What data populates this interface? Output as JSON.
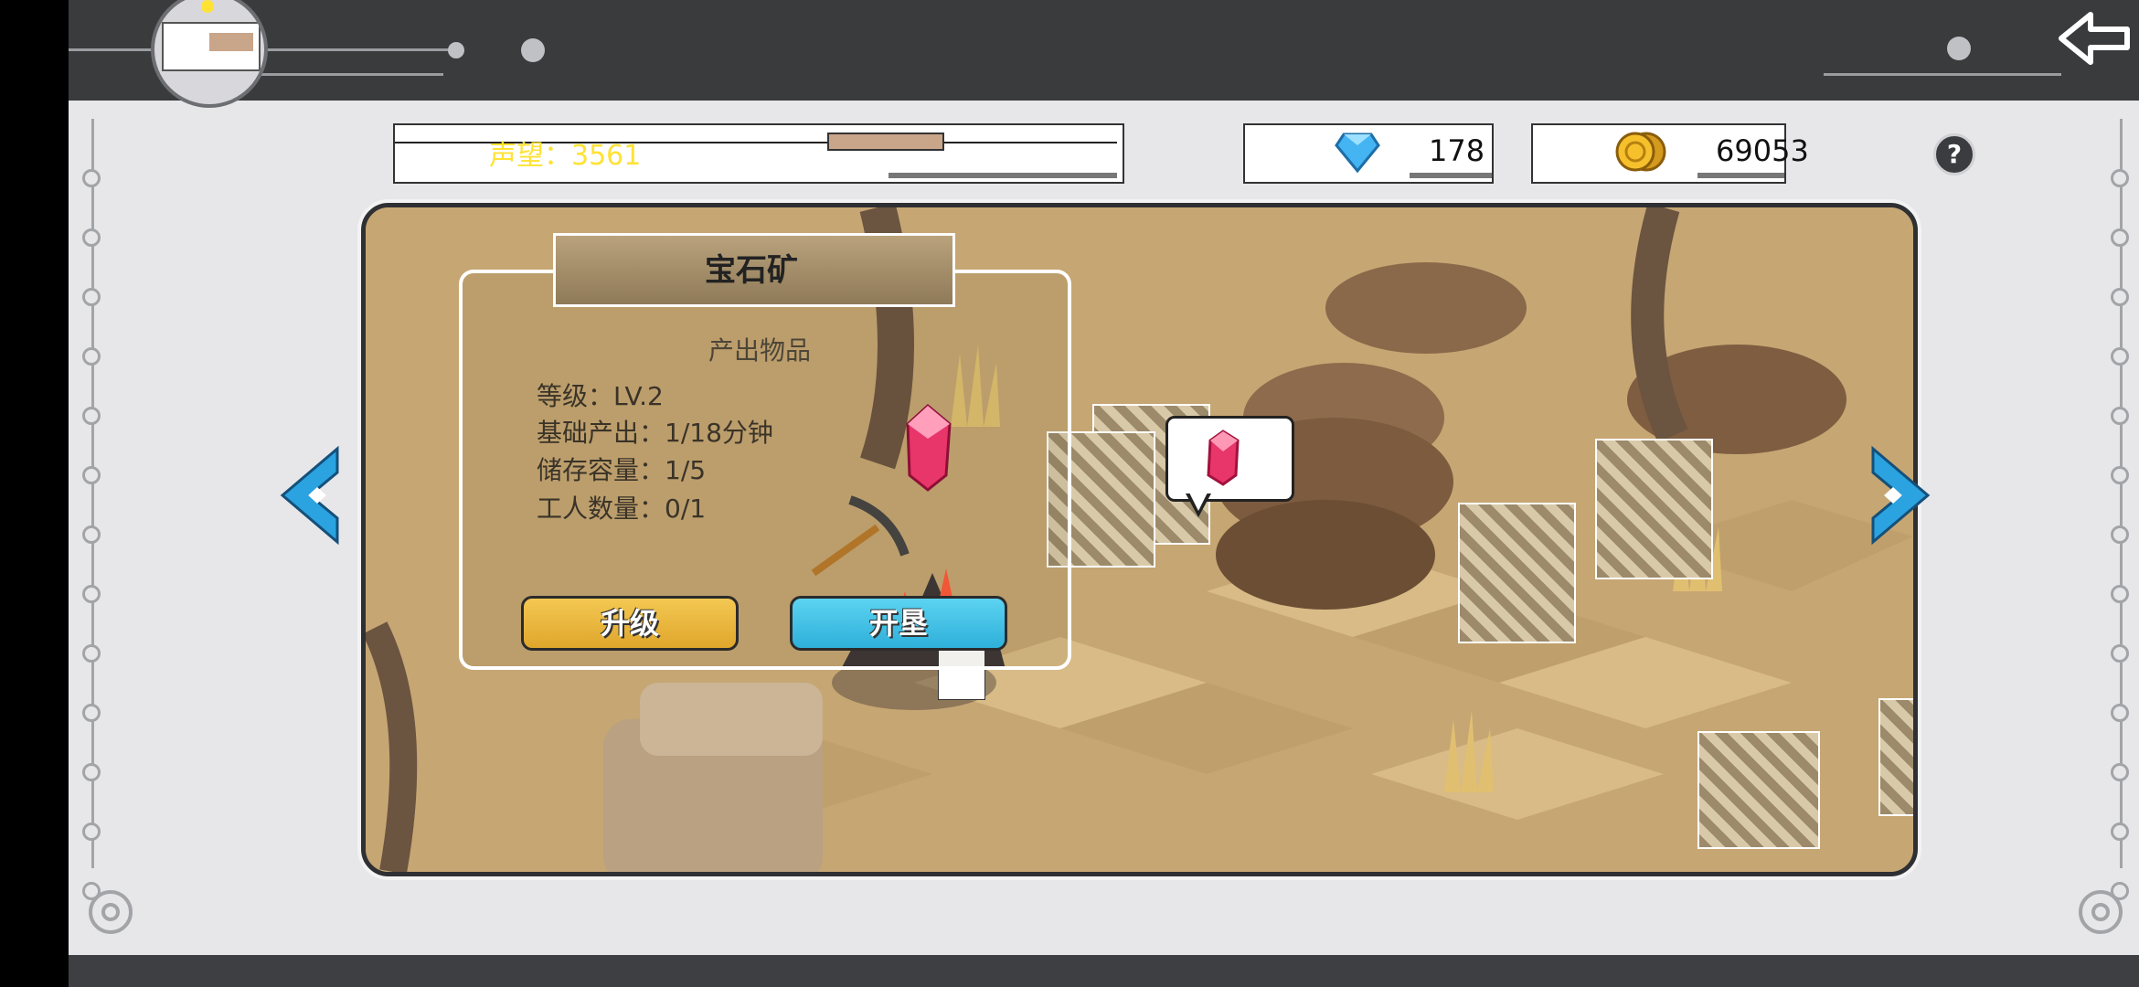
{
  "header": {
    "back_icon": "back-arrow-icon",
    "avatar_icon": "player-avatar"
  },
  "resources": {
    "reputation_label": "声望：3561",
    "diamonds": "178",
    "diamond_icon": "diamond-icon",
    "coins": "69053",
    "coin_icon": "gold-coin-icon",
    "help_label": "?"
  },
  "building": {
    "title": "宝石矿",
    "produce_label": "产出物品",
    "level": "等级：LV.2",
    "base_output": "基础产出：1/18分钟",
    "storage": "储存容量：1/5",
    "workers": "工人数量：0/1",
    "upgrade_label": "升级",
    "cultivate_label": "开垦"
  },
  "colors": {
    "upgrade_button": "#f3c852",
    "cultivate_button": "#2eb0da",
    "reputation_text": "#ffe233",
    "nav_arrow": "#2aa3e0"
  },
  "nav": {
    "prev_icon": "left-arrow-icon",
    "next_icon": "right-arrow-icon"
  }
}
